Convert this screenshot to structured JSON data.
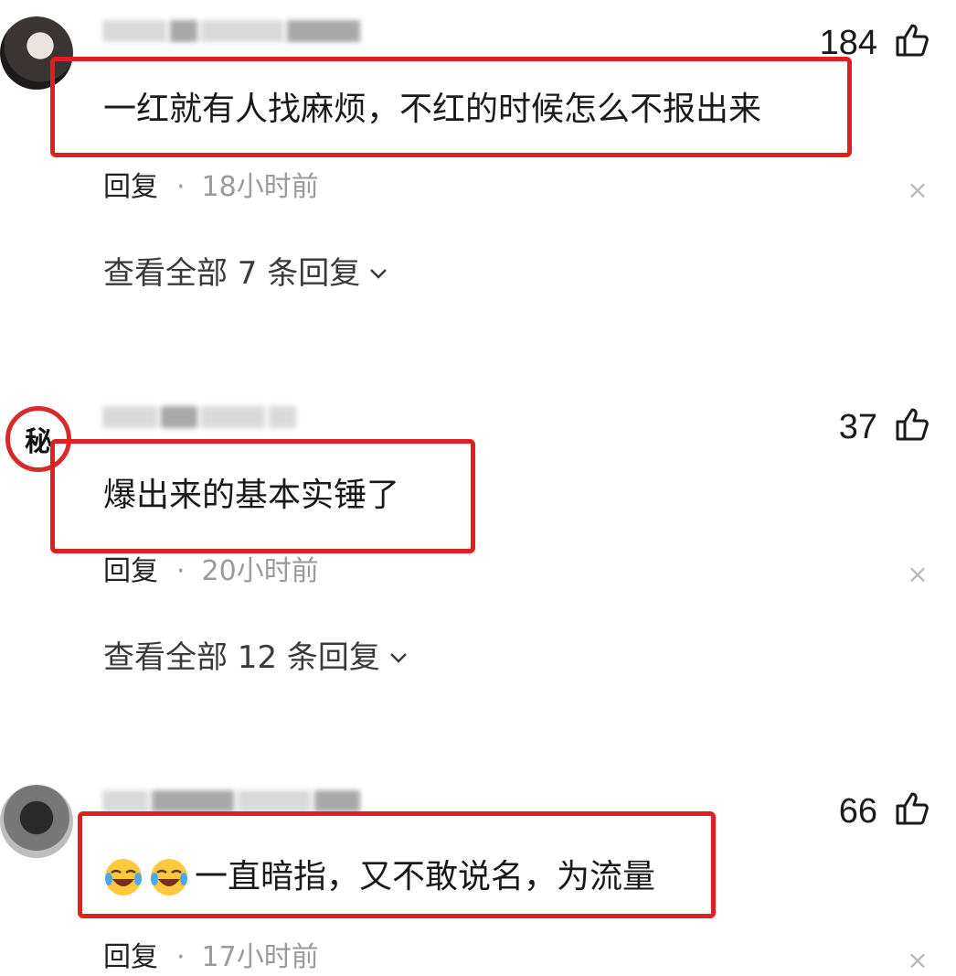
{
  "comments": [
    {
      "likes": "184",
      "text": "一红就有人找麻烦，不红的时候怎么不报出来",
      "reply_label": "回复",
      "separator": "·",
      "time": "18小时前",
      "view_replies": "查看全部 7 条回复"
    },
    {
      "avatar_glyph": "秘",
      "likes": "37",
      "text": "爆出来的基本实锤了",
      "reply_label": "回复",
      "separator": "·",
      "time": "20小时前",
      "view_replies": "查看全部 12 条回复"
    },
    {
      "likes": "66",
      "text": "一直暗指，又不敢说名，为流量",
      "emoji_icons": [
        "laughing-crying-emoji",
        "laughing-crying-emoji"
      ],
      "reply_label": "回复",
      "separator": "·",
      "time": "17小时前"
    }
  ],
  "colors": {
    "highlight_box": "#e02020",
    "meta_gray": "#9a9a9a",
    "avatar_ring": "#d72a2a"
  },
  "icons": {
    "like": "thumbs-up-icon",
    "close": "close-icon",
    "chevron": "chevron-down-icon"
  }
}
